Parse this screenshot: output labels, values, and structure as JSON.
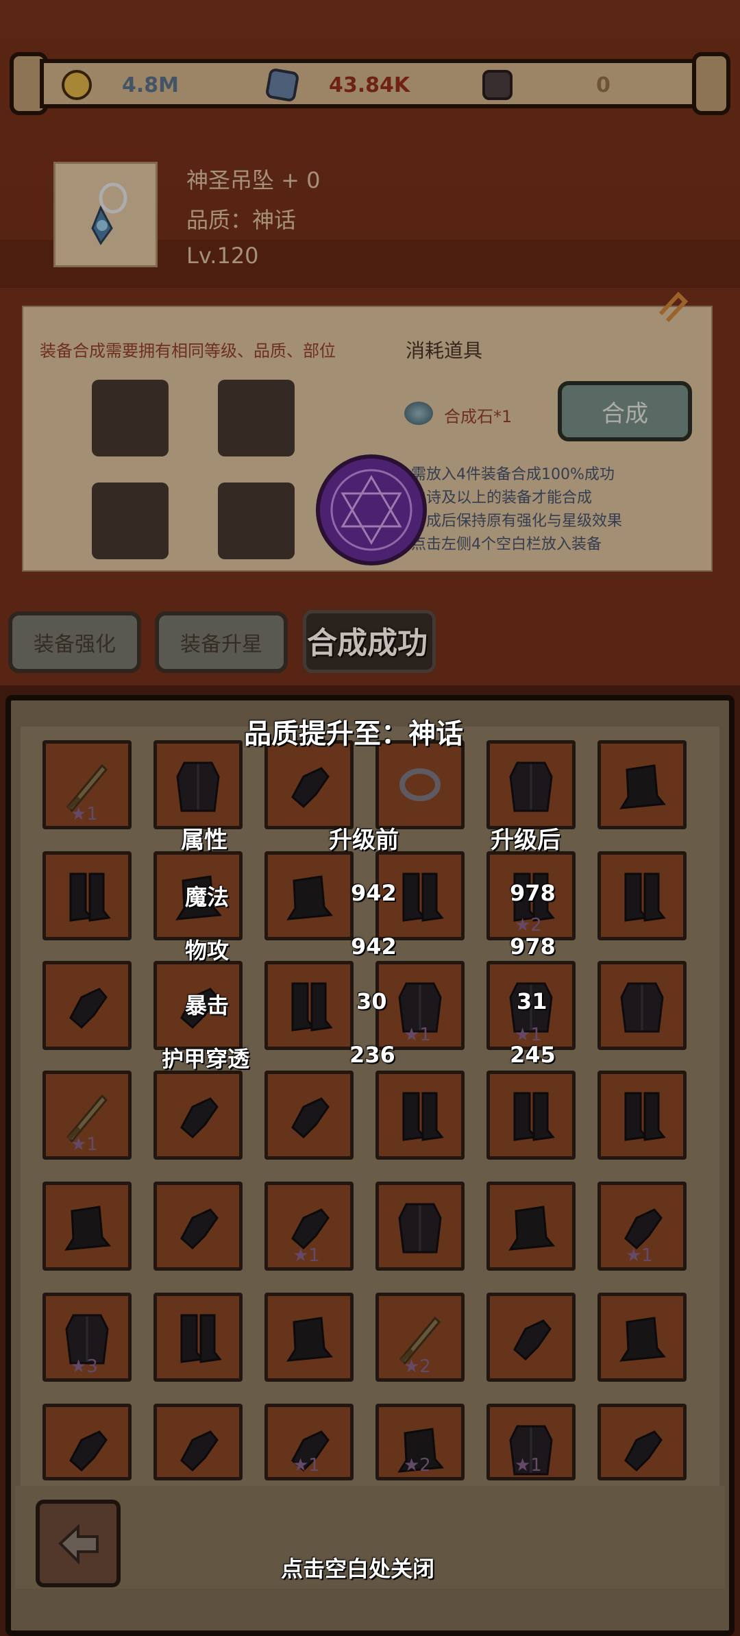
{
  "resources": [
    {
      "icon": "gold-coin-icon",
      "value": "4.8M",
      "color": "#4f6f8e"
    },
    {
      "icon": "blue-crystal-icon",
      "value": "43.84K",
      "color": "#8a2a1a"
    },
    {
      "icon": "dark-rune-icon",
      "value": "0",
      "color": "#8a6e4c"
    }
  ],
  "item": {
    "name": "神圣吊坠 + 0",
    "quality": "品质：神话",
    "level": "Lv.120"
  },
  "synthesis": {
    "hint": "装备合成需要拥有相同等级、品质、部位",
    "consume_title": "消耗道具",
    "stone_label": "合成石*1",
    "button_label": "合成",
    "rules": [
      "需放入4件装备合成100%成功",
      "史诗及以上的装备才能合成",
      "合成后保持原有强化与星级效果",
      "点击左侧4个空白栏放入装备"
    ]
  },
  "tabs": {
    "enhance": "装备强化",
    "upgrade_star": "装备升星"
  },
  "toast": "合成成功",
  "result": {
    "title": "品质提升至：神话",
    "headers": [
      "属性",
      "升级前",
      "升级后"
    ],
    "rows": [
      {
        "attr": "魔法",
        "before": "942",
        "after": "978"
      },
      {
        "attr": "物攻",
        "before": "942",
        "after": "978"
      },
      {
        "attr": "暴击",
        "before": "30",
        "after": "31"
      },
      {
        "attr": "护甲穿透",
        "before": "236",
        "after": "245"
      }
    ],
    "close_hint": "点击空白处关闭"
  },
  "inventory": [
    {
      "type": "sword",
      "star": "★1"
    },
    {
      "type": "armor",
      "star": ""
    },
    {
      "type": "glove",
      "star": ""
    },
    {
      "type": "ring",
      "star": ""
    },
    {
      "type": "armor",
      "star": ""
    },
    {
      "type": "hat",
      "star": ""
    },
    {
      "type": "boots",
      "star": ""
    },
    {
      "type": "hat",
      "star": ""
    },
    {
      "type": "hat",
      "star": ""
    },
    {
      "type": "boots",
      "star": ""
    },
    {
      "type": "boots",
      "star": "★2"
    },
    {
      "type": "boots",
      "star": ""
    },
    {
      "type": "glove",
      "star": ""
    },
    {
      "type": "glove",
      "star": ""
    },
    {
      "type": "boots",
      "star": ""
    },
    {
      "type": "armor",
      "star": "★1"
    },
    {
      "type": "armor",
      "star": "★1"
    },
    {
      "type": "armor",
      "star": ""
    },
    {
      "type": "sword",
      "star": "★1"
    },
    {
      "type": "glove",
      "star": ""
    },
    {
      "type": "glove",
      "star": ""
    },
    {
      "type": "boots",
      "star": ""
    },
    {
      "type": "boots",
      "star": ""
    },
    {
      "type": "boots",
      "star": ""
    },
    {
      "type": "hat",
      "star": ""
    },
    {
      "type": "glove",
      "star": ""
    },
    {
      "type": "glove",
      "star": "★1"
    },
    {
      "type": "armor",
      "star": ""
    },
    {
      "type": "hat",
      "star": ""
    },
    {
      "type": "glove",
      "star": "★1"
    },
    {
      "type": "armor",
      "star": "★3"
    },
    {
      "type": "boots",
      "star": ""
    },
    {
      "type": "hat",
      "star": ""
    },
    {
      "type": "sword",
      "star": "★2"
    },
    {
      "type": "glove",
      "star": ""
    },
    {
      "type": "hat",
      "star": ""
    },
    {
      "type": "glove",
      "star": ""
    },
    {
      "type": "glove",
      "star": ""
    },
    {
      "type": "glove",
      "star": "★1"
    },
    {
      "type": "hat",
      "star": "★2"
    },
    {
      "type": "armor",
      "star": "★1"
    },
    {
      "type": "glove",
      "star": ""
    }
  ]
}
